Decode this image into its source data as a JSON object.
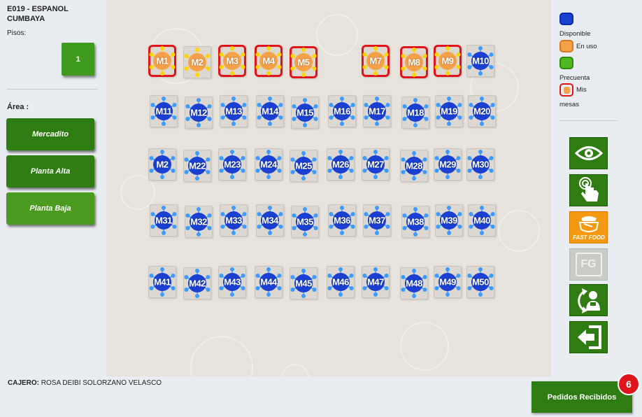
{
  "store": {
    "name": "E019 - ESPANOL\nCUMBAYA"
  },
  "floors": {
    "label": "Pisos:",
    "items": [
      "1"
    ]
  },
  "areas": {
    "label": "Área :",
    "items": [
      "Mercadito",
      "Planta Alta",
      "Planta Baja"
    ],
    "active": "Planta Baja"
  },
  "legend": {
    "available": "Disponible",
    "in_use": "En uso",
    "frequent": "Precuenta",
    "mine_1": "Mis",
    "mine_2": "mesas"
  },
  "colors": {
    "available": "#1a3fd1",
    "in_use": "#f5a14a",
    "frequent": "#4fb81f",
    "mine_border": "#e0141b",
    "button_green": "#2f7d12",
    "fast_food": "#f39a12"
  },
  "tools": [
    {
      "name": "view",
      "icon": "eye-icon"
    },
    {
      "name": "touch",
      "icon": "hand-touch-icon"
    },
    {
      "name": "fast-food",
      "icon": "fast-food-icon",
      "label": "FAST FOOD"
    },
    {
      "name": "fg",
      "icon": "fg-icon",
      "label": "FG"
    },
    {
      "name": "user-refresh",
      "icon": "user-refresh-icon"
    },
    {
      "name": "logout",
      "icon": "logout-arrow-icon"
    }
  ],
  "tables": [
    {
      "label": "M1",
      "status": "in_use",
      "mine": true
    },
    {
      "label": "M2",
      "status": "in_use",
      "mine": false
    },
    {
      "label": "M3",
      "status": "in_use",
      "mine": true
    },
    {
      "label": "M4",
      "status": "in_use",
      "mine": true
    },
    {
      "label": "M5",
      "status": "in_use",
      "mine": true
    },
    {
      "label": "M7",
      "status": "in_use",
      "mine": true
    },
    {
      "label": "M8",
      "status": "in_use",
      "mine": true
    },
    {
      "label": "M9",
      "status": "in_use",
      "mine": true
    },
    {
      "label": "M10",
      "status": "available",
      "mine": false
    },
    {
      "label": "M11",
      "status": "available",
      "mine": false
    },
    {
      "label": "M12",
      "status": "available",
      "mine": false
    },
    {
      "label": "M13",
      "status": "available",
      "mine": false
    },
    {
      "label": "M14",
      "status": "available",
      "mine": false
    },
    {
      "label": "M15",
      "status": "available",
      "mine": false
    },
    {
      "label": "M16",
      "status": "available",
      "mine": false
    },
    {
      "label": "M17",
      "status": "available",
      "mine": false
    },
    {
      "label": "M18",
      "status": "available",
      "mine": false
    },
    {
      "label": "M19",
      "status": "available",
      "mine": false
    },
    {
      "label": "M20",
      "status": "available",
      "mine": false
    },
    {
      "label": "M2",
      "status": "available",
      "mine": false
    },
    {
      "label": "M22",
      "status": "available",
      "mine": false
    },
    {
      "label": "M23",
      "status": "available",
      "mine": false
    },
    {
      "label": "M24",
      "status": "available",
      "mine": false
    },
    {
      "label": "M25",
      "status": "available",
      "mine": false
    },
    {
      "label": "M26",
      "status": "available",
      "mine": false
    },
    {
      "label": "M27",
      "status": "available",
      "mine": false
    },
    {
      "label": "M28",
      "status": "available",
      "mine": false
    },
    {
      "label": "M29",
      "status": "available",
      "mine": false
    },
    {
      "label": "M30",
      "status": "available",
      "mine": false
    },
    {
      "label": "M31",
      "status": "available",
      "mine": false
    },
    {
      "label": "M32",
      "status": "available",
      "mine": false
    },
    {
      "label": "M33",
      "status": "available",
      "mine": false
    },
    {
      "label": "M34",
      "status": "available",
      "mine": false
    },
    {
      "label": "M35",
      "status": "available",
      "mine": false
    },
    {
      "label": "M36",
      "status": "available",
      "mine": false
    },
    {
      "label": "M37",
      "status": "available",
      "mine": false
    },
    {
      "label": "M38",
      "status": "available",
      "mine": false
    },
    {
      "label": "M39",
      "status": "available",
      "mine": false
    },
    {
      "label": "M40",
      "status": "available",
      "mine": false
    },
    {
      "label": "M41",
      "status": "available",
      "mine": false
    },
    {
      "label": "M42",
      "status": "available",
      "mine": false
    },
    {
      "label": "M43",
      "status": "available",
      "mine": false
    },
    {
      "label": "M44",
      "status": "available",
      "mine": false
    },
    {
      "label": "M45",
      "status": "available",
      "mine": false
    },
    {
      "label": "M46",
      "status": "available",
      "mine": false
    },
    {
      "label": "M47",
      "status": "available",
      "mine": false
    },
    {
      "label": "M48",
      "status": "available",
      "mine": false
    },
    {
      "label": "M49",
      "status": "available",
      "mine": false
    },
    {
      "label": "M50",
      "status": "available",
      "mine": false
    }
  ],
  "footer": {
    "cashier_label": "CAJERO:",
    "cashier_name": " ROSA DEIBI SOLORZANO VELASCO",
    "orders_button": "Pedidos Recibidos",
    "orders_count": "6"
  }
}
